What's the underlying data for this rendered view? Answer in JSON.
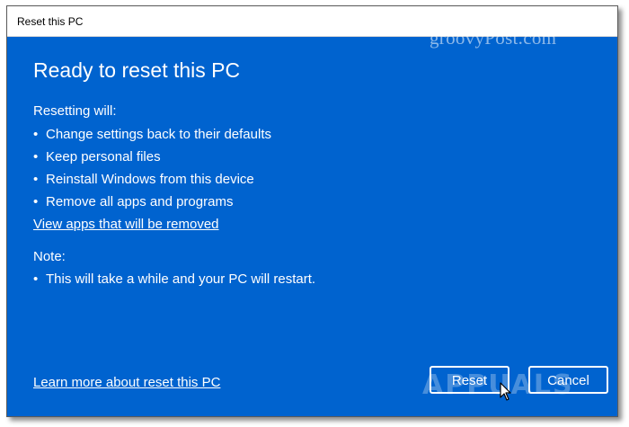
{
  "window": {
    "title": "Reset this PC"
  },
  "watermark": "groovyPost.com",
  "main": {
    "heading": "Ready to reset this PC",
    "resetting_label": "Resetting will:",
    "resetting_items": [
      "Change settings back to their defaults",
      "Keep personal files",
      "Reinstall Windows from this device",
      "Remove all apps and programs"
    ],
    "view_apps_link": "View apps that will be removed",
    "note_label": "Note:",
    "note_items": [
      "This will take a while and your PC will restart."
    ],
    "learn_more_link": "Learn more about reset this PC"
  },
  "buttons": {
    "reset": "Reset",
    "cancel": "Cancel"
  },
  "logo_watermark": "APPUALS",
  "bullet": "•",
  "colors": {
    "background": "#0063cf",
    "text": "#ffffff",
    "titlebar": "#ffffff"
  },
  "icons": {
    "cursor": "mouse-pointer-icon"
  }
}
